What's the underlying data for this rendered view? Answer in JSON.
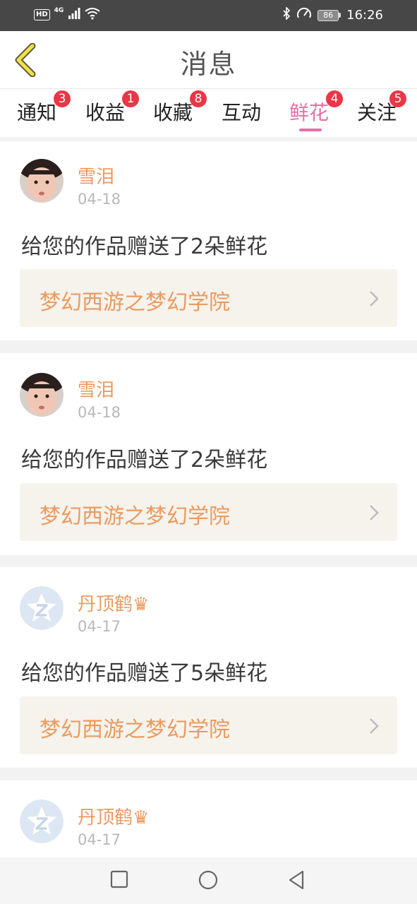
{
  "status_bar": {
    "hd": "HD",
    "network": "4G",
    "battery": "86",
    "time": "16:26"
  },
  "header": {
    "title": "消息"
  },
  "tabs": [
    {
      "label": "通知",
      "badge": "3"
    },
    {
      "label": "收益",
      "badge": "1"
    },
    {
      "label": "收藏",
      "badge": "8"
    },
    {
      "label": "互动",
      "badge": ""
    },
    {
      "label": "鲜花",
      "badge": "4"
    },
    {
      "label": "关注",
      "badge": "5"
    }
  ],
  "active_tab": "鲜花",
  "colors": {
    "accent": "#e86fa6",
    "name_orange": "#ec9a5f",
    "badge_red": "#ea3646",
    "back_arrow_yellow": "#f3e04a"
  },
  "messages": [
    {
      "user": "雪泪",
      "date": "04-18",
      "text": "给您的作品赠送了2朵鲜花",
      "work": "梦幻西游之梦幻学院",
      "avatar": "photo-avatar"
    },
    {
      "user": "雪泪",
      "date": "04-18",
      "text": "给您的作品赠送了2朵鲜花",
      "work": "梦幻西游之梦幻学院",
      "avatar": "photo-avatar"
    },
    {
      "user": "丹顶鹤♛",
      "date": "04-17",
      "text": "给您的作品赠送了5朵鲜花",
      "work": "梦幻西游之梦幻学院",
      "avatar": "default-qq-avatar"
    },
    {
      "user": "丹顶鹤♛",
      "date": "04-17",
      "avatar": "default-qq-avatar"
    }
  ]
}
